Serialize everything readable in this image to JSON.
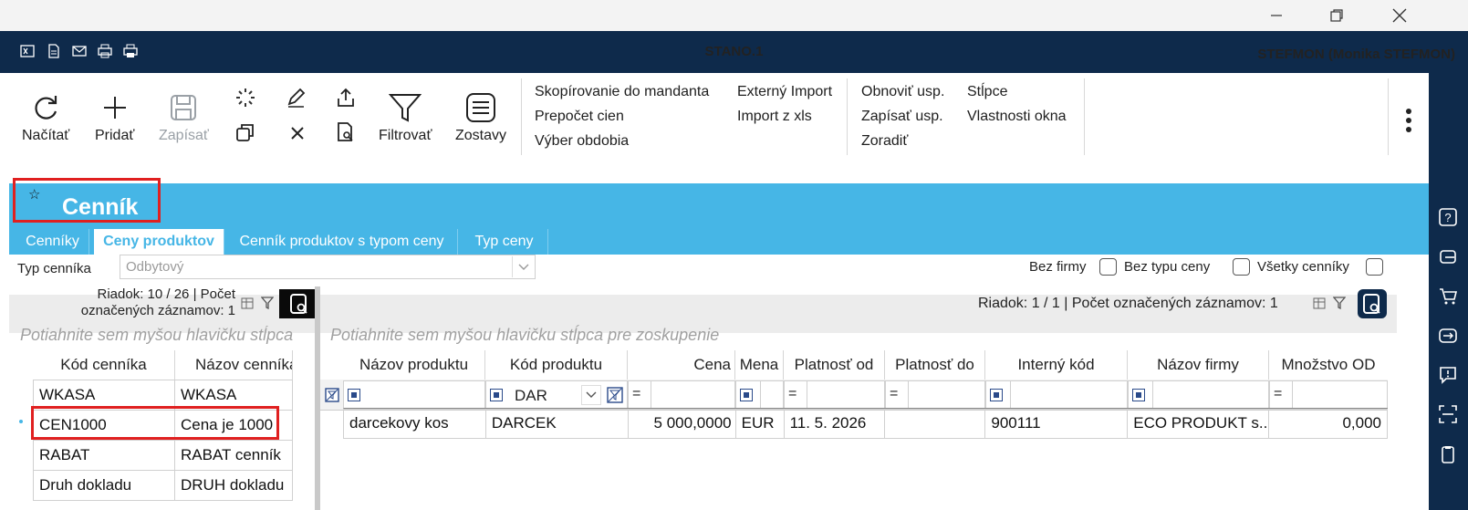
{
  "window": {
    "minimize_icon": "minimize-icon",
    "restore_icon": "restore-icon",
    "close_icon": "close-icon"
  },
  "appbar": {
    "title": "STANO.1",
    "user": "STEFMON (Monika STEFMON)"
  },
  "ribbon": {
    "load": "Načítať",
    "add": "Pridať",
    "save": "Zapísať",
    "filter": "Filtrovať",
    "reports": "Zostavy",
    "menu1": [
      "Skopírovanie do mandanta",
      "Prepočet cien",
      "Výber obdobia"
    ],
    "menu2": [
      "Externý Import",
      "Import z xls"
    ],
    "menu3": [
      "Obnoviť usp.",
      "Zapísať usp.",
      "Zoradiť"
    ],
    "menu4": [
      "Stĺpce",
      "Vlastnosti okna"
    ]
  },
  "header": {
    "title": "Cenník",
    "star": "☆"
  },
  "tabs": [
    "Cenníky",
    "Ceny produktov",
    "Cenník produktov s typom ceny",
    "Typ ceny"
  ],
  "filter": {
    "label": "Typ cenníka",
    "value": "Odbytový",
    "bez_firmy": "Bez firmy",
    "bez_typu": "Bez typu ceny",
    "vsetky": "Všetky cenníky"
  },
  "left_grid": {
    "status_line1": "Riadok: 10 / 26 | Počet",
    "status_line2": "označených záznamov: 1",
    "group_hint": "Potiahnite sem myšou hlavičku stĺpca",
    "headers": [
      "Kód cenníka",
      "Názov cenníka"
    ],
    "rows": [
      [
        "WKASA",
        "WKASA"
      ],
      [
        "CEN1000",
        "Cena je 1000"
      ],
      [
        "RABAT",
        "RABAT cenník"
      ],
      [
        "Druh dokladu",
        "DRUH  dokladu"
      ]
    ]
  },
  "right_grid": {
    "status": "Riadok: 1 / 1 | Počet označených záznamov: 1",
    "group_hint": "Potiahnite sem myšou hlavičku stĺpca pre zoskupenie",
    "headers": [
      "Názov produktu",
      "Kód produktu",
      "Cena",
      "Mena",
      "Platnosť od",
      "Platnosť do",
      "Interný kód",
      "Názov firmy",
      "Množstvo OD"
    ],
    "filter_value": "DAR",
    "eq": "=",
    "row": [
      "darcekovy kos",
      "DARCEK",
      "5 000,0000",
      "EUR",
      "11. 5. 2026",
      "",
      "900111",
      "ECO PRODUKT s...",
      "0,000"
    ]
  }
}
